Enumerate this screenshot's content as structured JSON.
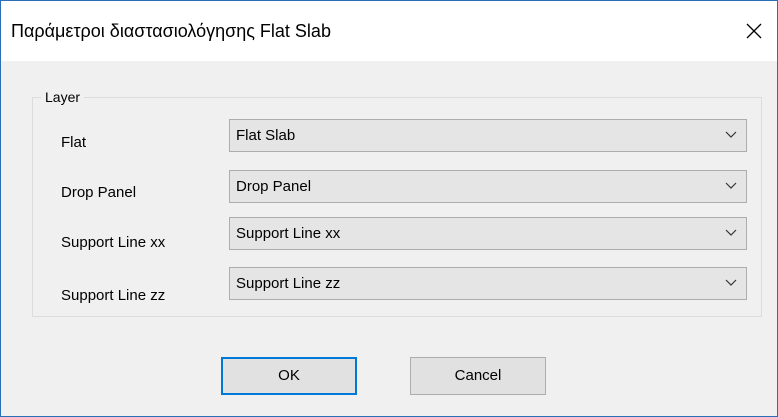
{
  "window": {
    "title": "Παράμετροι διαστασιολόγησης Flat Slab"
  },
  "layer_group": {
    "label": "Layer",
    "rows": [
      {
        "label": "Flat",
        "value": "Flat Slab"
      },
      {
        "label": "Drop Panel",
        "value": "Drop Panel"
      },
      {
        "label": "Support Line xx",
        "value": "Support Line xx"
      },
      {
        "label": "Support Line zz",
        "value": "Support Line zz"
      }
    ]
  },
  "buttons": {
    "ok_label": "OK",
    "cancel_label": "Cancel"
  },
  "icons": {
    "close": "close-icon",
    "dropdown": "chevron-down-icon"
  },
  "colors": {
    "dialog_bg": "#f0f0f0",
    "title_bg": "#ffffff",
    "window_border": "#2b6fb8",
    "default_button_border": "#0078d7"
  }
}
